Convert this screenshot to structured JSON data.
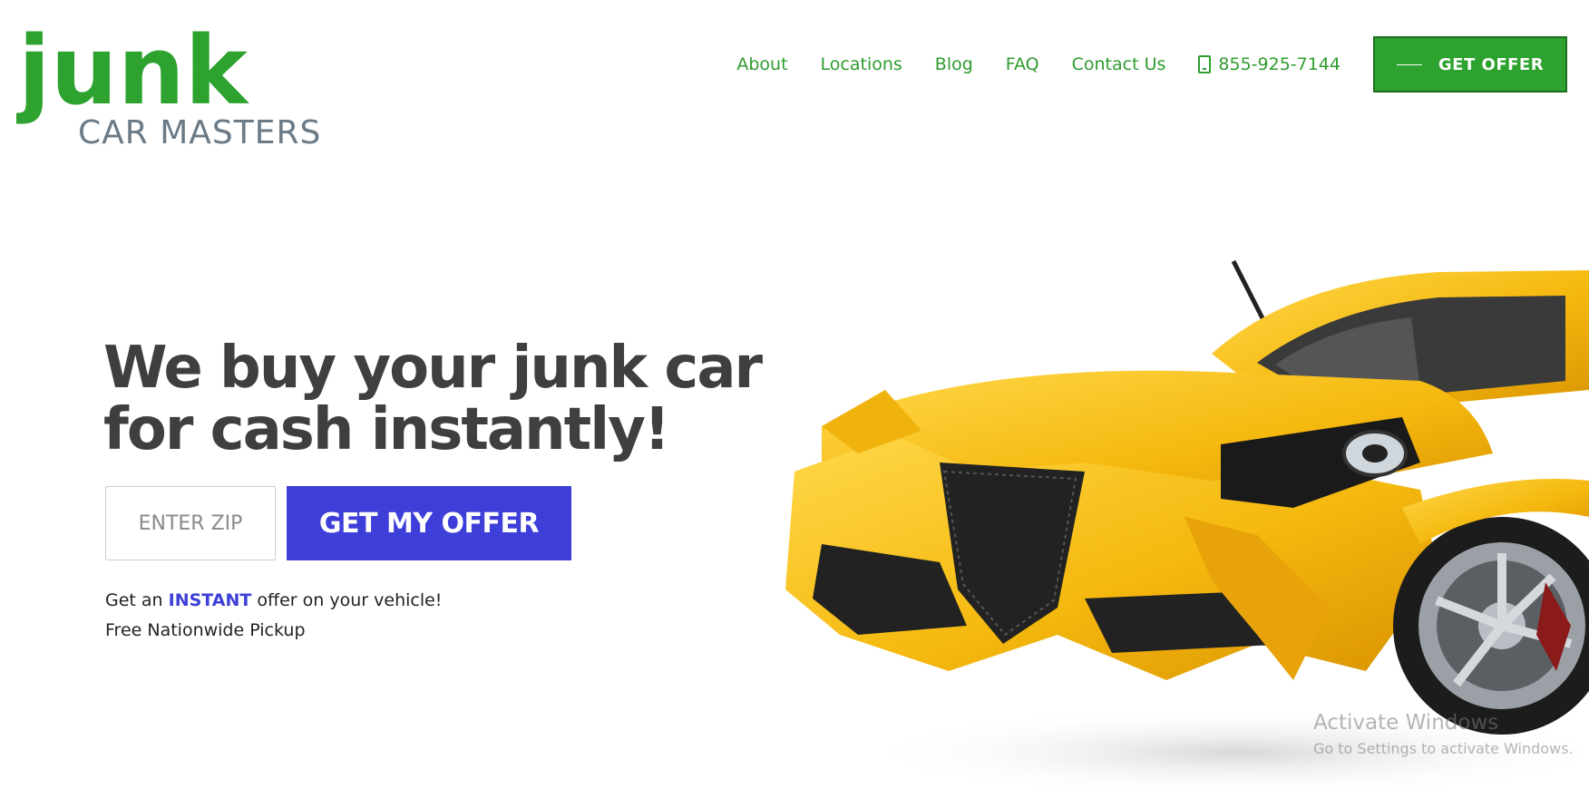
{
  "logo": {
    "word": "junk",
    "subtitle": "CAR MASTERS"
  },
  "nav": {
    "links": [
      "About",
      "Locations",
      "Blog",
      "FAQ",
      "Contact Us"
    ],
    "phone": "855-925-7144",
    "cta": "GET OFFER"
  },
  "hero": {
    "headline_line1": "We buy your junk car",
    "headline_line2": "for cash instantly!",
    "zip_placeholder": "ENTER ZIP",
    "submit_label": "GET MY OFFER",
    "sub_prefix": "Get an",
    "sub_highlight": "INSTANT",
    "sub_suffix": "offer on your vehicle!",
    "sub_line2": "Free Nationwide Pickup"
  },
  "watermark": {
    "title": "Activate Windows",
    "subtitle": "Go to Settings to activate Windows."
  },
  "colors": {
    "brand_green": "#2e9c2e",
    "accent_blue": "#3d3fd8",
    "headline_gray": "#3f3f3f",
    "car_yellow": "#f7c21a"
  }
}
